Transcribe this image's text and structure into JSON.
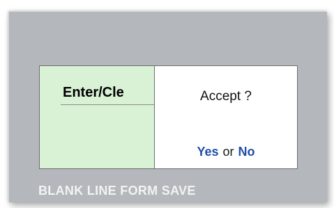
{
  "form": {
    "field_label": "Enter/Cle",
    "caption": "BLANK LINE FORM SAVE"
  },
  "dialog": {
    "prompt": "Accept ?",
    "yes_label": "Yes",
    "or_label": "or",
    "no_label": "No"
  },
  "colors": {
    "panel_background": "#b4b7bb",
    "entry_background": "#d9f2d5",
    "dialog_background": "#ffffff",
    "choice_color": "#1f4fa8",
    "caption_color": "#f2f3f4"
  }
}
